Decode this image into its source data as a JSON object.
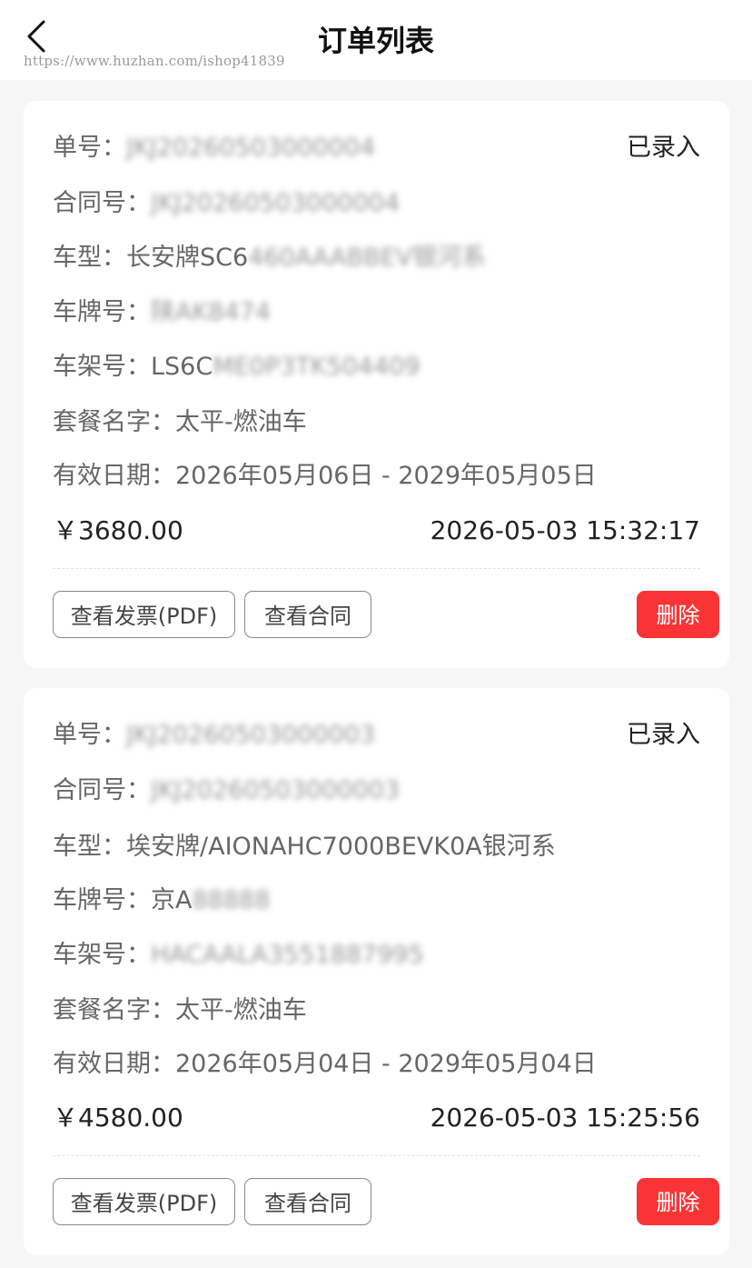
{
  "header": {
    "title": "订单列表",
    "back_icon": "chevron-left-icon",
    "watermark": "https://www.huzhan.com/ishop41839"
  },
  "labels": {
    "order_no": "单号：",
    "contract_no": "合同号：",
    "car_model": "车型：",
    "plate_no": "车牌号：",
    "vin": "车架号：",
    "package": "套餐名字：",
    "valid_period": "有效日期：",
    "btn_invoice": "查看发票(PDF)",
    "btn_contract": "查看合同",
    "btn_delete": "删除"
  },
  "orders": [
    {
      "order_no": "JKJ20260503000004",
      "status": "已录入",
      "contract_no": "JKJ20260503000004",
      "car_model_visible": "长安牌SC6",
      "car_model_blurred": "460AAABBEV银河系",
      "plate_visible": "陕AK8474",
      "vin_visible": "LS6C",
      "vin_blurred": "ME0P3TK504409",
      "package": "太平-燃油车",
      "valid_period": "2026年05月06日 - 2029年05月05日",
      "price": "￥3680.00",
      "created_at": "2026-05-03 15:32:17"
    },
    {
      "order_no": "JKJ20260503000003",
      "status": "已录入",
      "contract_no": "JKJ20260503000003",
      "car_model_visible": "埃安牌/AIONAHC7000BEVK0A银河系",
      "car_model_blurred": "",
      "plate_visible": "京A",
      "plate_blurred": "88888",
      "vin_visible": "",
      "vin_blurred": "HACAALA3551887995",
      "package": "太平-燃油车",
      "valid_period": "2026年05月04日 - 2029年05月04日",
      "price": "￥4580.00",
      "created_at": "2026-05-03 15:25:56"
    }
  ],
  "colors": {
    "background": "#f6f6f6",
    "card": "#ffffff",
    "delete_button": "#fa3434",
    "text_primary": "#222222",
    "text_secondary": "#666666"
  }
}
